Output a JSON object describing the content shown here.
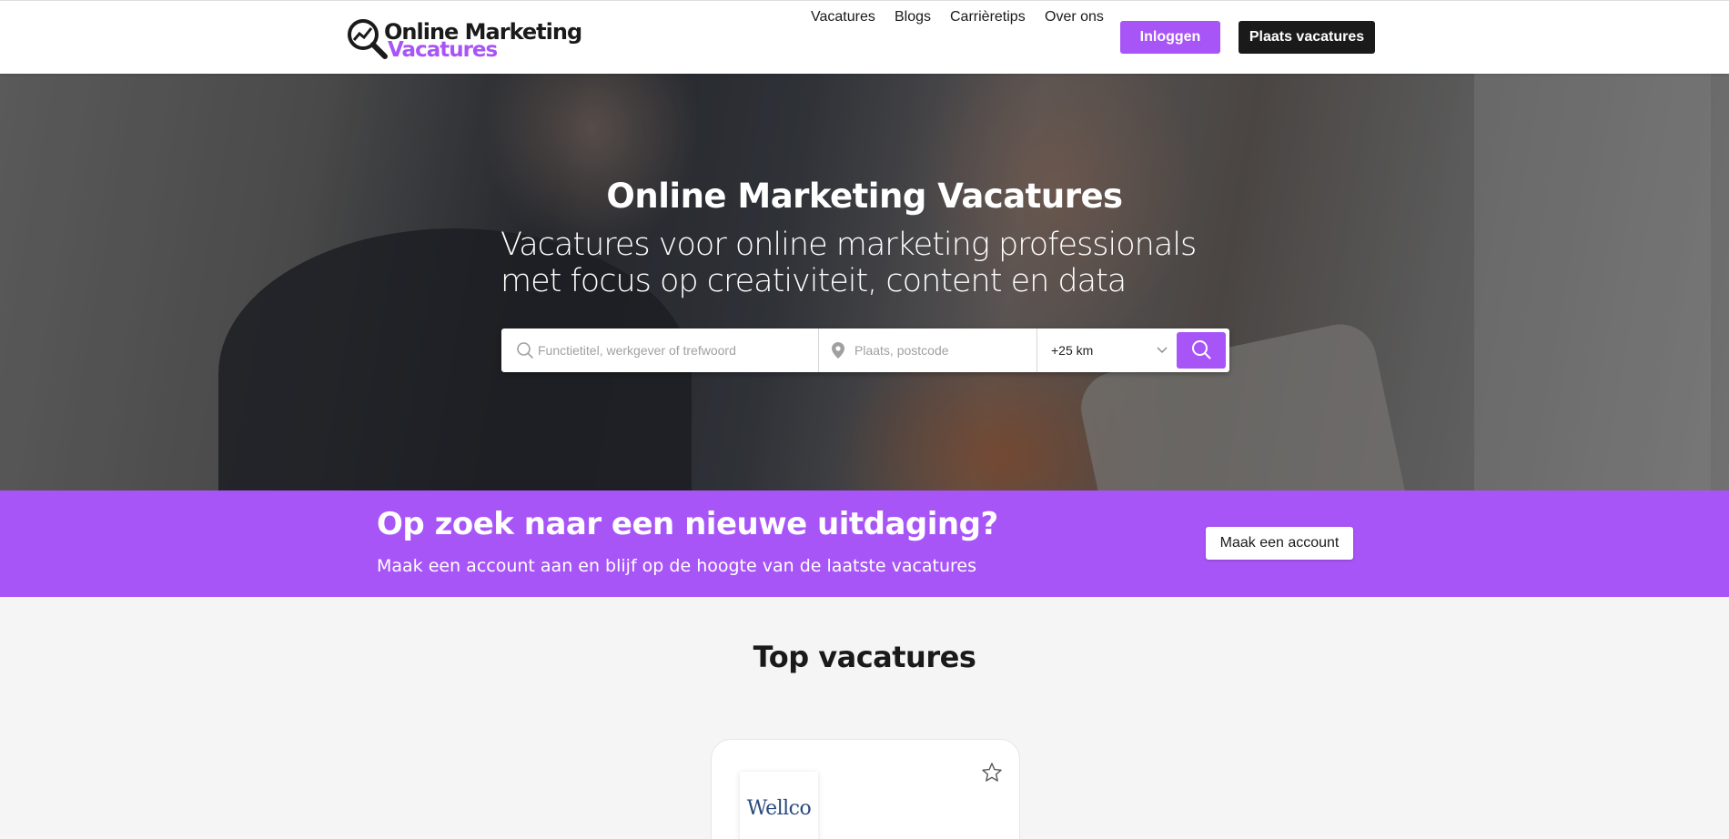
{
  "header": {
    "logo_line1": "Online Marketing",
    "logo_line2": "Vacatures",
    "nav": [
      {
        "label": "Vacatures"
      },
      {
        "label": "Blogs"
      },
      {
        "label": "Carrièretips"
      },
      {
        "label": "Over ons"
      }
    ],
    "login_label": "Inloggen",
    "post_label": "Plaats vacatures"
  },
  "hero": {
    "title": "Online Marketing Vacatures",
    "subtitle": "Vacatures voor online marketing professionals met focus op creativiteit, content en data",
    "search": {
      "keyword_placeholder": "Functietitel, werkgever of trefwoord",
      "location_placeholder": "Plaats, postcode",
      "radius_value": "+25 km"
    }
  },
  "band": {
    "title": "Op zoek naar een nieuwe uitdaging?",
    "text": "Maak een account aan en blijf op de hoogte van de laatste vacatures",
    "button_label": "Maak een account"
  },
  "top_jobs": {
    "title": "Top vacatures",
    "cards": [
      {
        "company_logo_text": "Wellco"
      }
    ]
  },
  "colors": {
    "accent": "#a855f7",
    "dark": "#1a1a1a",
    "background": "#f5f5f5"
  }
}
